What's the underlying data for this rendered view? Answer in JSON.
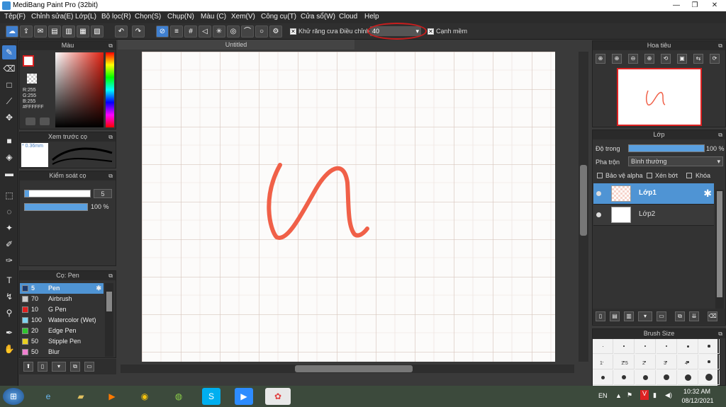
{
  "window": {
    "title": "MediBang Paint Pro (32bit)",
    "minimize": "—",
    "restore": "❐",
    "close": "✕"
  },
  "menu": [
    "Tệp(F)",
    "Chỉnh sửa(E)",
    "Lớp(L)",
    "Bộ lọc(R)",
    "Chọn(S)",
    "Chụp(N)",
    "Màu (C)",
    "Xem(V)",
    "Công cụ(T)",
    "Cửa sổ(W)",
    "Cloud",
    "Help"
  ],
  "toolbar": {
    "antialias_label": "Khử răng cưa",
    "adjust_label": "Điều chỉnh",
    "adjust_value": "40",
    "smooth_label": "Cạnh mềm",
    "check_mark": "✕"
  },
  "color_panel": {
    "title": "Màu",
    "r": "R:255",
    "g": "G:255",
    "b": "B:255",
    "hex": "#FFFFFF",
    "foreground": "#d92020",
    "background": "#ffffff"
  },
  "brush_preview_panel": {
    "title": "Xem trước cọ",
    "size_label": "0.36mm"
  },
  "brush_control_panel": {
    "title": "Kiểm soát cọ",
    "size_value": "5",
    "opacity_value": "100 %",
    "opacity_fraction": 1.0
  },
  "brush_panel": {
    "title": "Cọ: Pen",
    "items": [
      {
        "size": "5",
        "name": "Pen",
        "color": "#1e3a6e",
        "selected": true
      },
      {
        "size": "70",
        "name": "Airbrush",
        "color": "#cccccc"
      },
      {
        "size": "10",
        "name": "G Pen",
        "color": "#e02020"
      },
      {
        "size": "100",
        "name": "Watercolor (Wet)",
        "color": "#7fd3f0"
      },
      {
        "size": "20",
        "name": "Edge Pen",
        "color": "#2fc42f"
      },
      {
        "size": "50",
        "name": "Stipple Pen",
        "color": "#e8d020"
      },
      {
        "size": "50",
        "name": "Blur",
        "color": "#f080d0"
      }
    ]
  },
  "document": {
    "tab_title": "Untitled",
    "stroke_color": "#f06048",
    "grid_color": "#c8a898"
  },
  "navigator_panel": {
    "title": "Hoa tiêu"
  },
  "layer_panel": {
    "title": "Lớp",
    "opacity_label": "Độ trong",
    "opacity_value": "100 %",
    "opacity_fraction": 1.0,
    "blend_label": "Pha trộn",
    "blend_value": "Bình thường",
    "protect_alpha": "Bảo vệ alpha",
    "clip": "Xén bớt",
    "lock": "Khóa",
    "layers": [
      {
        "name": "Lớp1",
        "selected": true
      },
      {
        "name": "Lớp2",
        "selected": false
      }
    ]
  },
  "brush_size_panel": {
    "title": "Brush Size",
    "sizes": [
      "1",
      "1.5",
      "2",
      "3",
      "4"
    ]
  },
  "taskbar": {
    "lang": "EN",
    "time": "10:32 AM",
    "date": "08/12/2021",
    "start_icon": "windows-start-icon"
  }
}
